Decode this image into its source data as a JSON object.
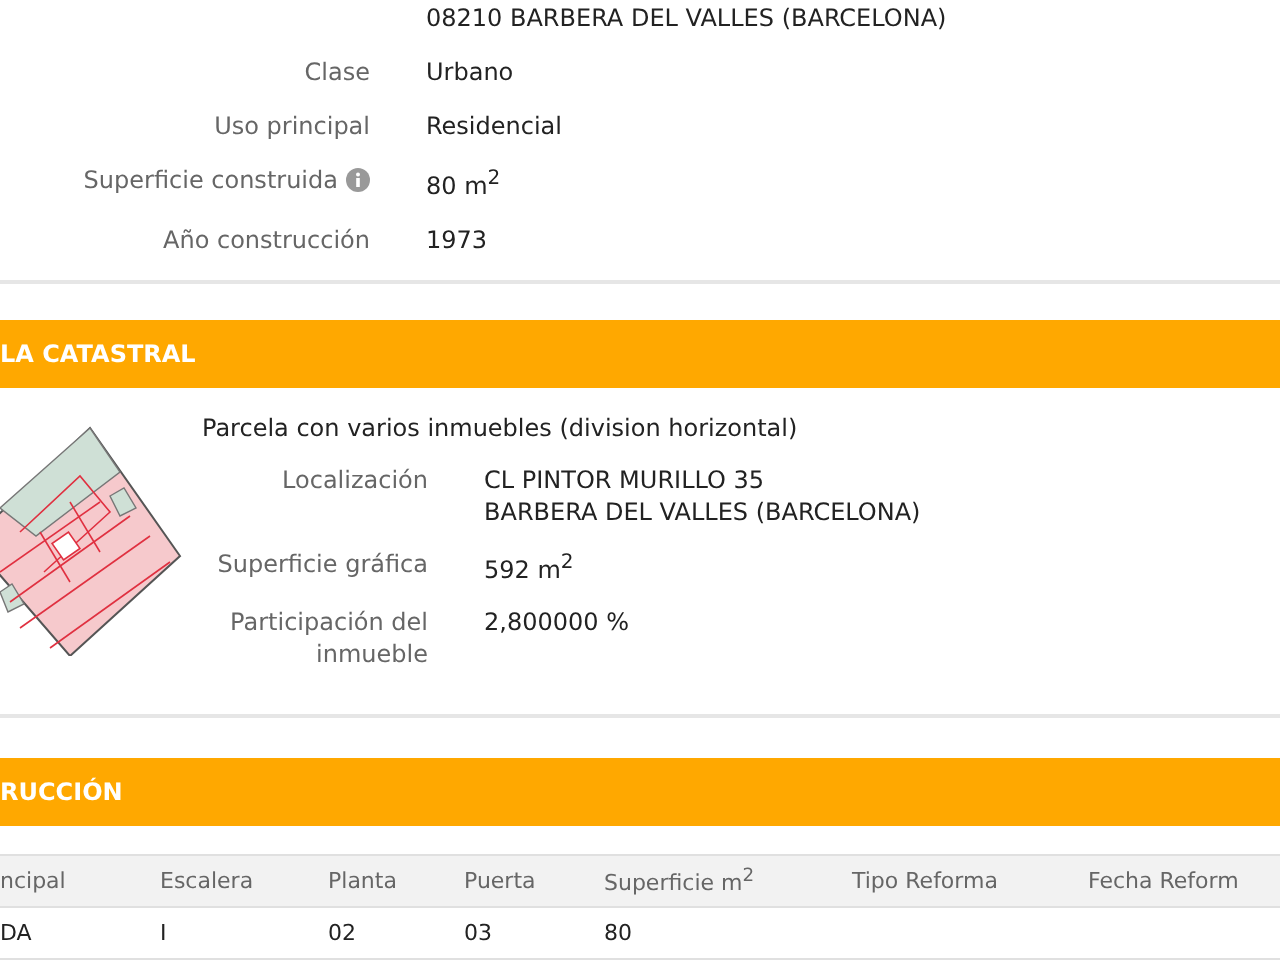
{
  "top_fields": [
    {
      "value": "08210 BARBERA DEL VALLES (BARCELONA)"
    },
    {
      "label": "Clase",
      "value": "Urbano"
    },
    {
      "label": "Uso principal",
      "value": "Residencial"
    },
    {
      "label": "Superficie construida",
      "value": "80 m$^{2}$",
      "info": true
    },
    {
      "label": "Año construcción",
      "value": "1973"
    }
  ],
  "parcel_section": {
    "title": "LA CATASTRAL",
    "description": "Parcela con varios inmuebles (division horizontal)",
    "fields": [
      {
        "label": "Localización",
        "lines": [
          "CL PINTOR MURILLO 35",
          "BARBERA DEL VALLES (BARCELONA)"
        ]
      },
      {
        "label": "Superficie gráfica",
        "lines": [
          "592 m$^{2}$"
        ]
      },
      {
        "label": "Participación del inmueble",
        "lines": [
          "2,800000 %"
        ]
      }
    ]
  },
  "construction_section": {
    "title": "RUCCIÓN",
    "table": {
      "columns": [
        "ncipal",
        "Escalera",
        "Planta",
        "Puerta",
        "Superficie m$^{2}$",
        "Tipo Reforma",
        "Fecha Reform"
      ],
      "rows": [
        [
          "DA",
          "I",
          "02",
          "03",
          "80",
          "",
          ""
        ]
      ]
    }
  }
}
